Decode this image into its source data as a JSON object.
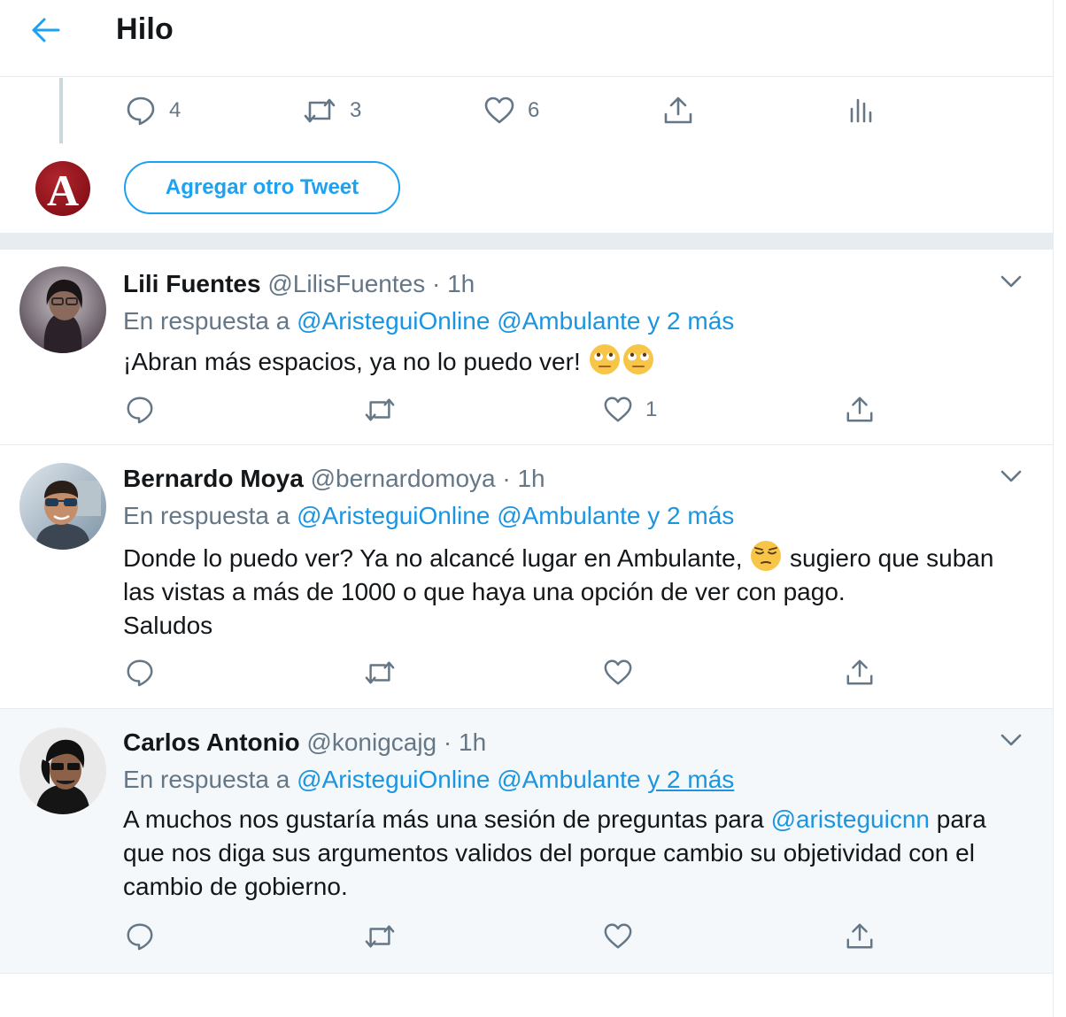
{
  "header": {
    "title": "Hilo",
    "back_icon": "arrow-left-icon"
  },
  "thread_tail": {
    "reply_count": "4",
    "retweet_count": "3",
    "like_count": "6"
  },
  "compose": {
    "avatar_letter": "A",
    "add_button": "Agregar otro Tweet"
  },
  "replies": [
    {
      "name": "Lili Fuentes",
      "handle": "@LilisFuentes",
      "time": "1h",
      "reply_prefix": "En respuesta a",
      "reply_targets": "@AristeguiOnline @Ambulante",
      "reply_more": "y 2 más",
      "text": "¡Abran más espacios, ya no lo puedo ver!",
      "emoji": [
        "face-with-rolling-eyes-emoji",
        "face-with-rolling-eyes-emoji"
      ],
      "like_count": "1"
    },
    {
      "name": "Bernardo Moya",
      "handle": "@bernardomoya",
      "time": "1h",
      "reply_prefix": "En respuesta a",
      "reply_targets": "@AristeguiOnline @Ambulante",
      "reply_more": "y 2 más",
      "text_before_emoji": "Donde lo puedo ver? Ya no alcancé lugar en Ambulante,",
      "emoji": [
        "pensive-face-emoji"
      ],
      "text_after_emoji": "sugiero que subań las vistas a más de 1000 o que haya una opción de ver con pago.",
      "text_line3": "Saludos"
    },
    {
      "name": "Carlos Antonio",
      "handle": "@konigcajg",
      "time": "1h",
      "reply_prefix": "En respuesta a",
      "reply_targets": "@AristeguiOnline @Ambulante",
      "reply_more": "y 2 más",
      "text_before_mention": "A muchos nos gustaría más una sesión de preguntas para",
      "mention": "@aristeguicnn",
      "text_after_mention": "para que nos diga sus argumentos validos del porque cambio su objetividad con el cambio de gobierno."
    }
  ],
  "colors": {
    "accent": "#1da1f2",
    "link": "#1b95e0",
    "muted": "#657786",
    "divider": "#e6ecf0",
    "highlight_bg": "#f5f8fa"
  }
}
